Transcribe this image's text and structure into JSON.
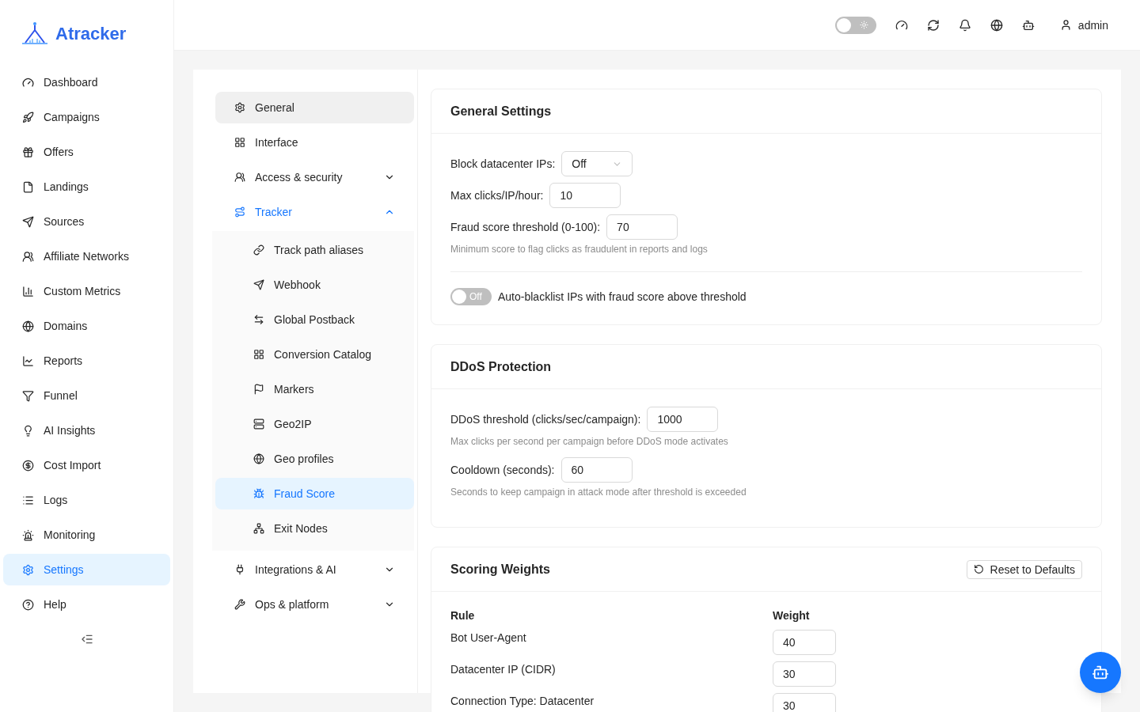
{
  "sidebar": {
    "logo": "Atracker",
    "items": [
      {
        "label": "Dashboard",
        "selected": false
      },
      {
        "label": "Campaigns",
        "selected": false
      },
      {
        "label": "Offers",
        "selected": false
      },
      {
        "label": "Landings",
        "selected": false
      },
      {
        "label": "Sources",
        "selected": false
      },
      {
        "label": "Affiliate Networks",
        "selected": false
      },
      {
        "label": "Custom Metrics",
        "selected": false
      },
      {
        "label": "Domains",
        "selected": false
      },
      {
        "label": "Reports",
        "selected": false
      },
      {
        "label": "Funnel",
        "selected": false
      },
      {
        "label": "AI Insights",
        "selected": false
      },
      {
        "label": "Cost Import",
        "selected": false
      },
      {
        "label": "Logs",
        "selected": false
      },
      {
        "label": "Monitoring",
        "selected": false
      },
      {
        "label": "Settings",
        "selected": true
      },
      {
        "label": "Help",
        "selected": false
      }
    ]
  },
  "header": {
    "theme_toggle": {
      "on": false
    },
    "user": "admin"
  },
  "settings_nav": [
    {
      "label": "General",
      "selected": true
    },
    {
      "label": "Interface",
      "selected": false
    },
    {
      "label": "Access & security",
      "selected": false,
      "expanded": false
    },
    {
      "label": "Tracker",
      "selected": false,
      "expanded": true,
      "children": [
        {
          "label": "Track path aliases",
          "selected": false
        },
        {
          "label": "Webhook",
          "selected": false
        },
        {
          "label": "Global Postback",
          "selected": false
        },
        {
          "label": "Conversion Catalog",
          "selected": false
        },
        {
          "label": "Markers",
          "selected": false
        },
        {
          "label": "Geo2IP",
          "selected": false
        },
        {
          "label": "Geo profiles",
          "selected": false
        },
        {
          "label": "Fraud Score",
          "selected": true
        },
        {
          "label": "Exit Nodes",
          "selected": false
        }
      ]
    },
    {
      "label": "Integrations & AI",
      "selected": false,
      "expanded": false
    },
    {
      "label": "Ops & platform",
      "selected": false,
      "expanded": false
    }
  ],
  "sections": [
    {
      "title": "General Settings",
      "rows": [
        {
          "kind": "select",
          "label": "Block datacenter IPs:",
          "value": "Off"
        },
        {
          "kind": "input",
          "label": "Max clicks/IP/hour:",
          "value": "10"
        },
        {
          "kind": "input",
          "label": "Fraud score threshold (0-100):",
          "value": "70"
        },
        {
          "kind": "hint",
          "text": "Minimum score to flag clicks as fraudulent in reports and logs"
        },
        {
          "kind": "toggle",
          "label": "Auto-blacklist IPs with fraud score above threshold",
          "on": false,
          "state_text": "Off"
        }
      ]
    },
    {
      "title": "DDoS Protection",
      "rows": [
        {
          "kind": "input",
          "label": "DDoS threshold (clicks/sec/campaign):",
          "value": "1000"
        },
        {
          "kind": "hint",
          "text": "Max clicks per second per campaign before DDoS mode activates"
        },
        {
          "kind": "input",
          "label": "Cooldown (seconds):",
          "value": "60"
        },
        {
          "kind": "hint",
          "text": "Seconds to keep campaign in attack mode after threshold is exceeded"
        }
      ]
    },
    {
      "title": "Scoring Weights",
      "button": "Reset to Defaults",
      "columns": [
        "Rule",
        "Weight"
      ],
      "table": [
        {
          "rule": "Bot User-Agent",
          "weight": "40"
        },
        {
          "rule": "Datacenter IP (CIDR)",
          "weight": "30"
        },
        {
          "rule": "Connection Type: Datacenter",
          "weight": "30"
        }
      ]
    }
  ]
}
